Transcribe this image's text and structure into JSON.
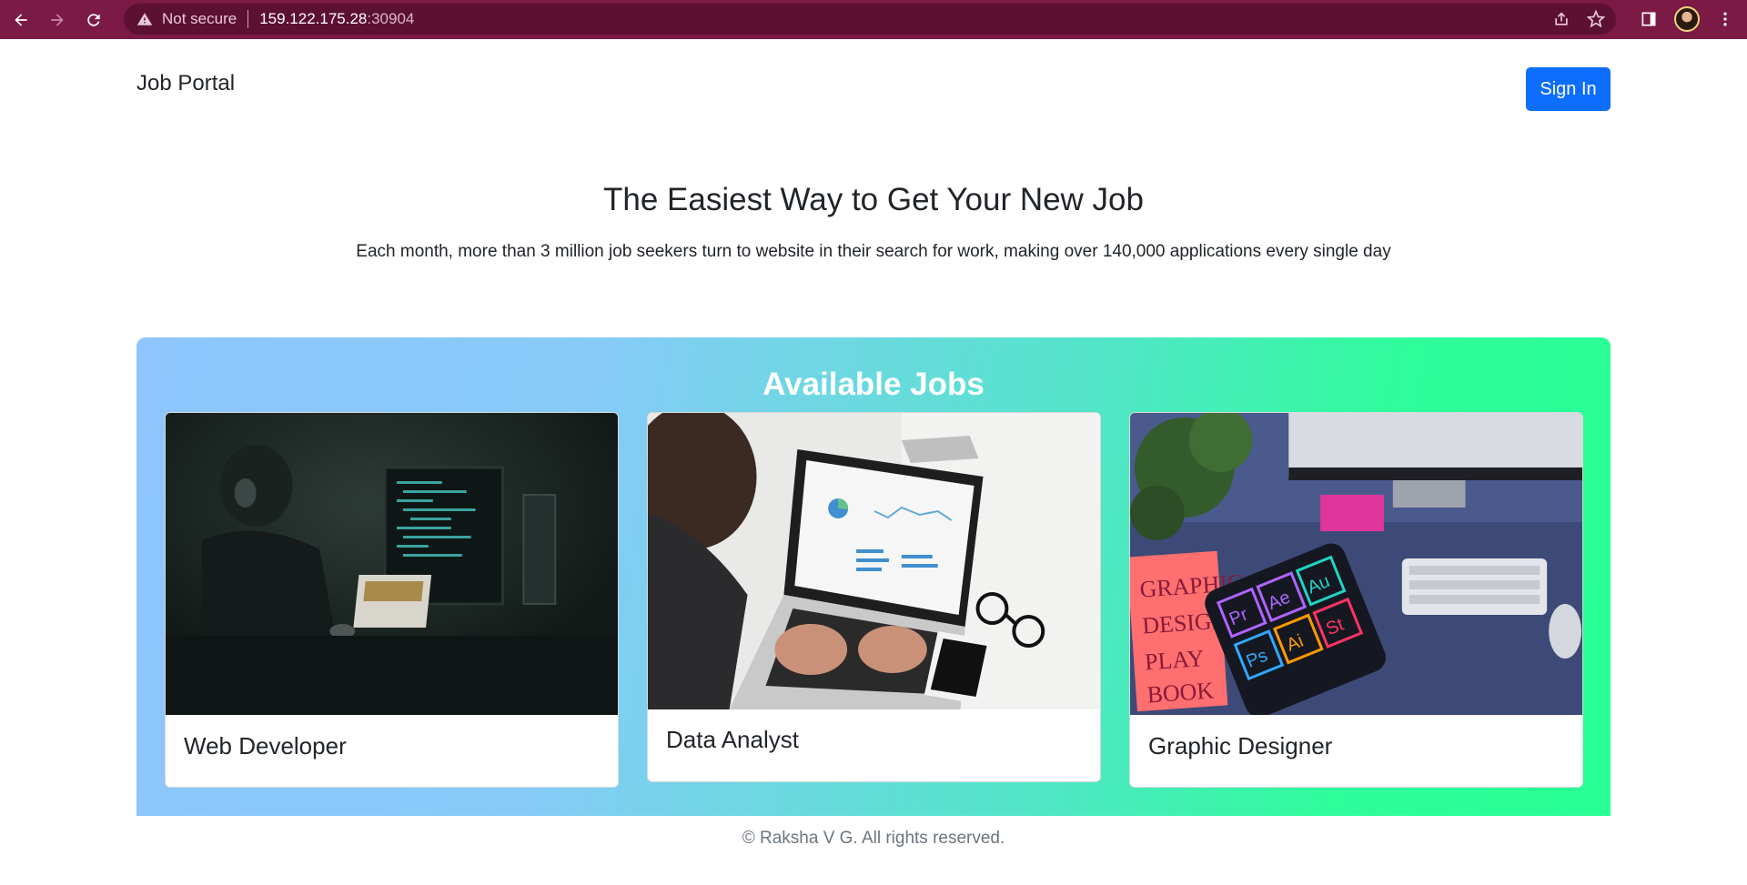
{
  "browser": {
    "security_label": "Not secure",
    "url_host": "159.122.175.28",
    "url_port": ":30904"
  },
  "navbar": {
    "brand": "Job Portal",
    "signin_label": "Sign In"
  },
  "hero": {
    "title": "The Easiest Way to Get Your New Job",
    "subtitle": "Each month, more than 3 million job seekers turn to website in their search for work, making over 140,000 applications every single day"
  },
  "jobs": {
    "heading": "Available Jobs",
    "cards": [
      {
        "title": "Web Developer"
      },
      {
        "title": "Data Analyst"
      },
      {
        "title": "Graphic Designer"
      }
    ]
  },
  "footer": {
    "text": "© Raksha V G. All rights reserved."
  },
  "colors": {
    "browser_frame": "#7b1a44",
    "primary_button": "#0d6efd",
    "gradient_start": "#8ec5fc",
    "gradient_end": "#27ff95"
  }
}
